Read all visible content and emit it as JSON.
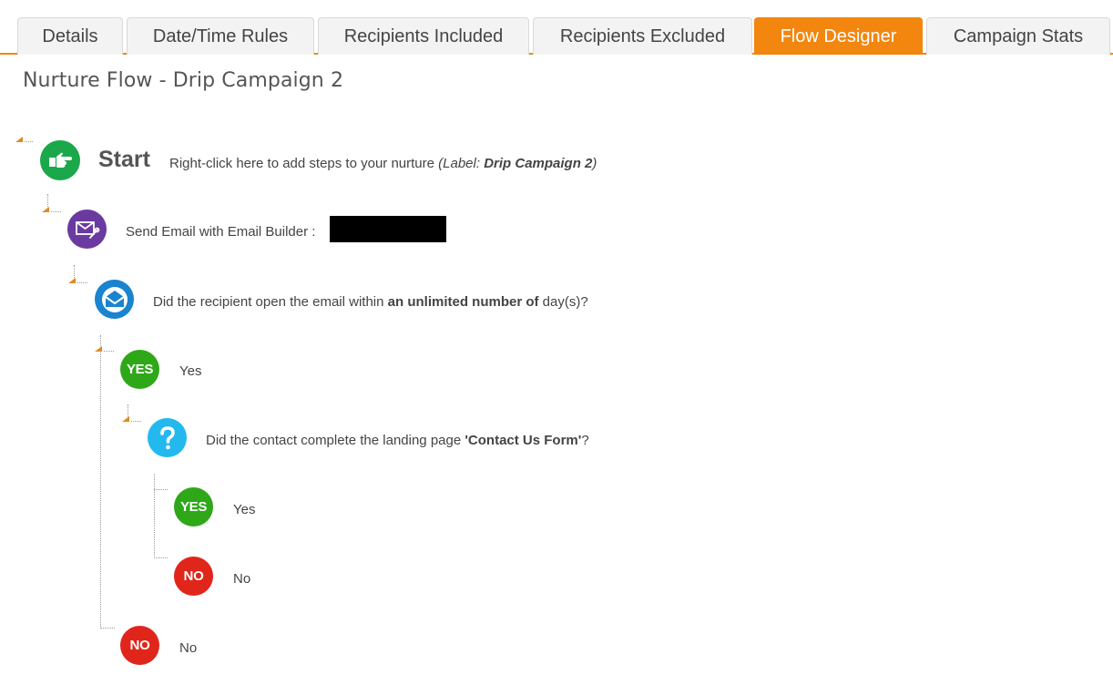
{
  "tabs": [
    {
      "label": "Details",
      "active": false
    },
    {
      "label": "Date/Time Rules",
      "active": false
    },
    {
      "label": "Recipients Included",
      "active": false
    },
    {
      "label": "Recipients Excluded",
      "active": false
    },
    {
      "label": "Flow Designer",
      "active": true
    },
    {
      "label": "Campaign Stats",
      "active": false
    }
  ],
  "colors": {
    "accent": "#f2860f",
    "start_green": "#1aa84a",
    "email_purple": "#6a3aa0",
    "open_blue": "#1a84cf",
    "question_cyan": "#23b9ef",
    "yes_green": "#2ea818",
    "no_red": "#e0261a"
  },
  "page_title": "Nurture Flow - Drip Campaign 2",
  "tree": {
    "start": {
      "icon": "hand-pointer-icon",
      "title": "Start",
      "hint": "Right-click here to add steps to your nurture",
      "label_prefix": "(Label: ",
      "label_value": "Drip Campaign 2",
      "label_suffix": ")"
    },
    "send_email": {
      "icon": "email-builder-icon",
      "text": "Send Email with Email Builder :",
      "value_redacted": true
    },
    "opened_check": {
      "icon": "envelope-open-icon",
      "text_before": "Did the recipient open the email within ",
      "bold": "an unlimited number of",
      "text_after": " day(s)?"
    },
    "opened_yes": {
      "badge": "YES",
      "label": "Yes",
      "landing_check": {
        "icon": "question-icon",
        "text_before": "Did the contact complete the landing page ",
        "bold": "'Contact Us Form'",
        "text_after": "?",
        "yes": {
          "badge": "YES",
          "label": "Yes"
        },
        "no": {
          "badge": "NO",
          "label": "No"
        }
      }
    },
    "opened_no": {
      "badge": "NO",
      "label": "No"
    }
  }
}
